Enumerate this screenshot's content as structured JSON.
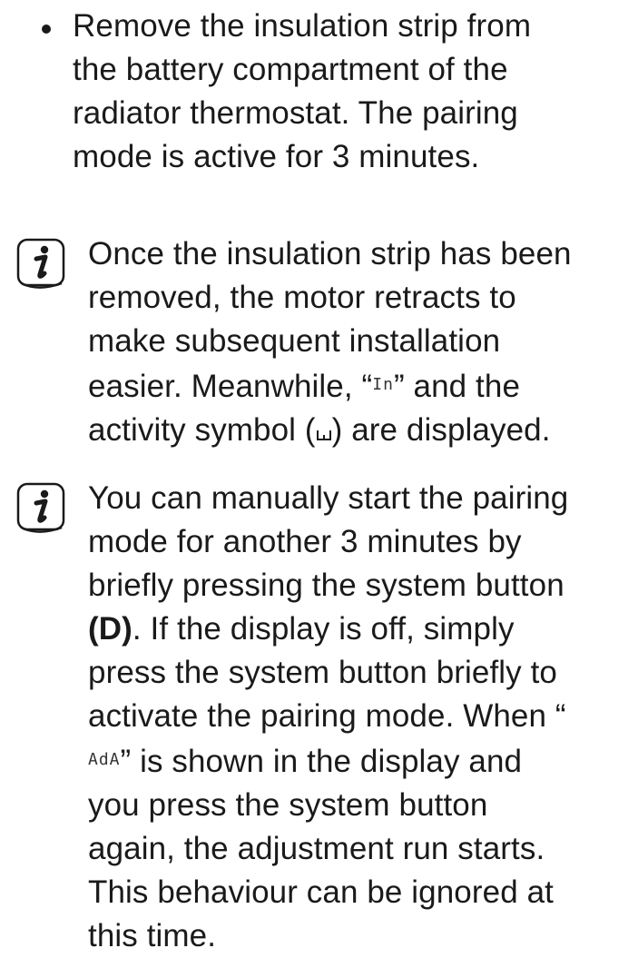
{
  "bullet": {
    "lines": [
      "Remove the insulation strip from",
      "the battery compartment of the",
      "radiator thermostat. The pairing",
      "mode is active for 3 minutes."
    ]
  },
  "note1": {
    "icon": "info-icon",
    "line1": "Once the insulation strip has been",
    "line2": "removed, the motor retracts to",
    "line3": "make subsequent installation",
    "line4_before": "easier. Meanwhile, “",
    "display_text": "In",
    "line4_after": "” and the",
    "line5_before": "activity symbol (",
    "line5_after": ") are displayed."
  },
  "note2": {
    "icon": "info-icon",
    "line1": "You can manually start the pairing",
    "line2": "mode for another 3 minutes by",
    "line3": "briefly pressing the system button",
    "line4_bold": "(D)",
    "line4_rest": ". If the display is off, simply",
    "line5": "press the system button briefly to",
    "line6": "activate the pairing mode. When “",
    "line7_display": "AdA",
    "line7_rest": "” is shown in the display and",
    "line8": "you press the system button",
    "line9": "again, the adjustment run starts.",
    "line10": "This behaviour can be ignored at",
    "line11": "this time."
  }
}
